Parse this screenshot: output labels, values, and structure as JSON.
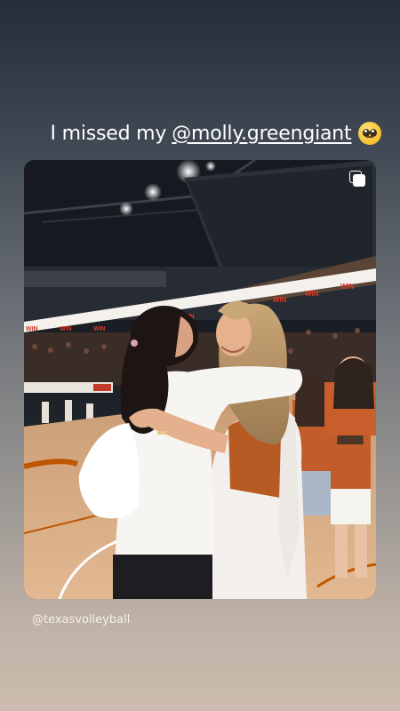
{
  "story": {
    "caption_text": "I missed my",
    "caption_mention": "@molly.greengiant",
    "caption_emoji": "pleading-face-emoji",
    "source_tag": "@texasvolleyball"
  },
  "photo": {
    "banner_word": "WIN",
    "multi_post_icon": "multiple-photos-icon"
  },
  "colors": {
    "accent_orange": "#bf5700",
    "banner_red": "#d23a2a",
    "court_wood": "#d7ad86"
  }
}
